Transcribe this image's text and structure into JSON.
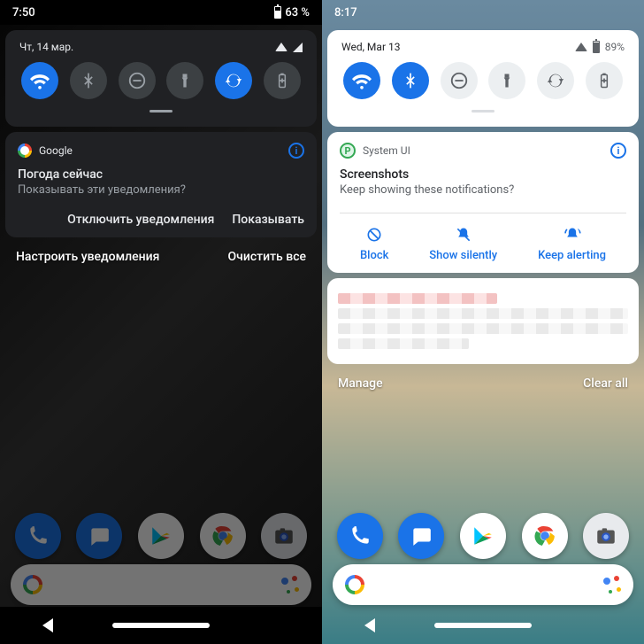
{
  "left": {
    "status": {
      "time": "7:50",
      "battery_pct": "63 %"
    },
    "qs": {
      "date": "Чт, 14 мар.",
      "tiles": [
        {
          "name": "wifi",
          "on": true
        },
        {
          "name": "bluetooth",
          "on": false
        },
        {
          "name": "dnd",
          "on": false
        },
        {
          "name": "flashlight",
          "on": false
        },
        {
          "name": "autorotate",
          "on": true
        },
        {
          "name": "battery-saver",
          "on": false
        }
      ]
    },
    "notif": {
      "app": "Google",
      "title": "Погода сейчас",
      "body": "Показывать эти уведомления?",
      "actions": {
        "block": "Отключить уведомления",
        "show": "Показывать"
      }
    },
    "footer": {
      "manage": "Настроить уведомления",
      "clear": "Очистить все"
    }
  },
  "right": {
    "status": {
      "time": "8:17",
      "battery_pct": "89%"
    },
    "qs": {
      "date": "Wed, Mar 13",
      "tiles": [
        {
          "name": "wifi",
          "on": true
        },
        {
          "name": "bluetooth",
          "on": true
        },
        {
          "name": "dnd",
          "on": false
        },
        {
          "name": "flashlight",
          "on": false
        },
        {
          "name": "autorotate",
          "on": false
        },
        {
          "name": "battery-saver",
          "on": false
        }
      ]
    },
    "notif": {
      "app": "System UI",
      "title": "Screenshots",
      "body": "Keep showing these notifications?",
      "choices": {
        "block": "Block",
        "silent": "Show silently",
        "alert": "Keep alerting"
      }
    },
    "footer": {
      "manage": "Manage",
      "clear": "Clear all"
    }
  },
  "dock_apps": [
    "phone",
    "messages",
    "play-store",
    "chrome",
    "camera"
  ]
}
